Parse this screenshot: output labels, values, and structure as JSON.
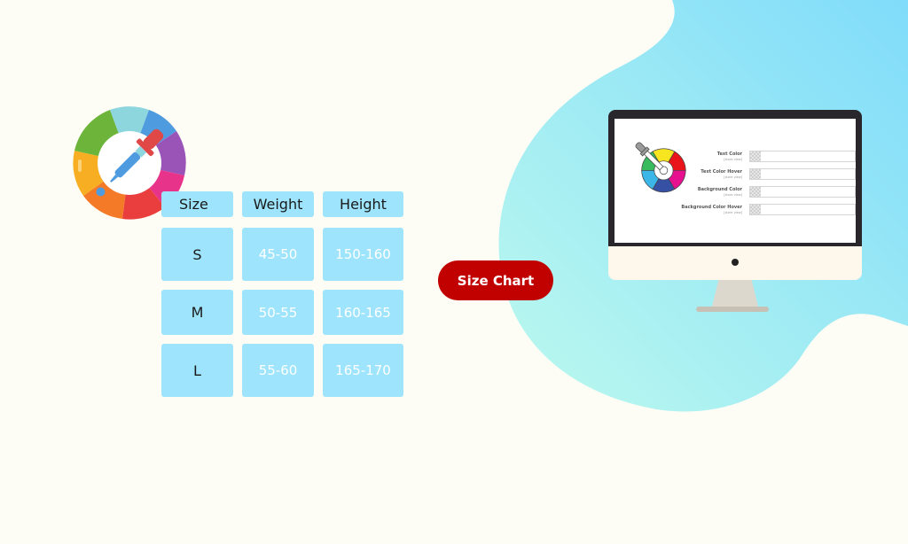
{
  "colors": {
    "background": "#fefdf5",
    "blob_gradient_start": "#b9f7ef",
    "blob_gradient_end": "#86def8",
    "table_cell": "#9de4fc",
    "button": "#c10000"
  },
  "size_table": {
    "headers": [
      "Size",
      "Weight",
      "Height"
    ],
    "rows": [
      {
        "size": "S",
        "weight": "45-50",
        "height": "150-160"
      },
      {
        "size": "M",
        "weight": "50-55",
        "height": "160-165"
      },
      {
        "size": "L",
        "weight": "55-60",
        "height": "165-170"
      }
    ]
  },
  "cta_button": {
    "label": "Size Chart"
  },
  "monitor": {
    "fields": [
      {
        "label": "Text Color",
        "scope": "[store view]"
      },
      {
        "label": "Text Color Hover",
        "scope": "[store view]"
      },
      {
        "label": "Background Color",
        "scope": "[store view]"
      },
      {
        "label": "Background Color Hover",
        "scope": "[store view]"
      }
    ]
  },
  "icons": {
    "large": "color-wheel-with-eyedropper",
    "small": "color-wheel-with-eyedropper"
  }
}
